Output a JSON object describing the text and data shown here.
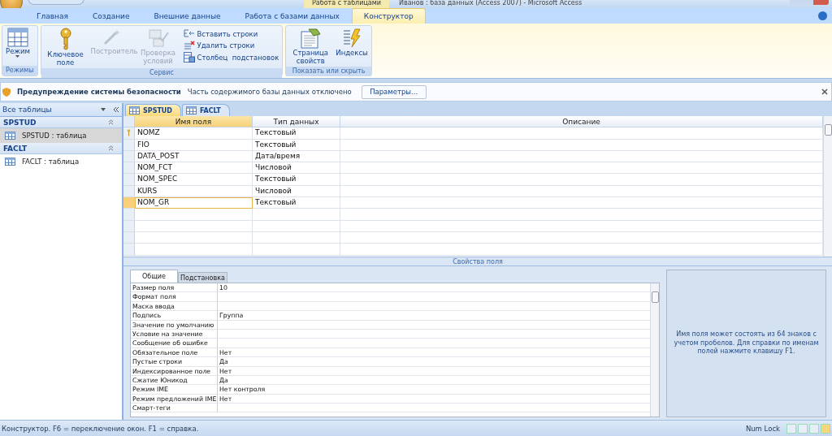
{
  "window": {
    "context_tab": "Работа с таблицами",
    "title": "Иванов : база данных (Access 2007) - Microsoft Access"
  },
  "ribbon_tabs": [
    {
      "label": "Главная",
      "selected": false
    },
    {
      "label": "Создание",
      "selected": false
    },
    {
      "label": "Внешние данные",
      "selected": false
    },
    {
      "label": "Работа с базами данных",
      "selected": false
    },
    {
      "label": "Конструктор",
      "selected": true
    }
  ],
  "ribbon_groups": [
    {
      "title": "Режимы",
      "items": [
        {
          "kind": "large",
          "label": "Режим",
          "dropdown": true,
          "disabled": false
        }
      ]
    },
    {
      "title": "Сервис",
      "items": [
        {
          "kind": "large",
          "label": "Ключевое поле",
          "disabled": false
        },
        {
          "kind": "large",
          "label": "Построитель",
          "disabled": true
        },
        {
          "kind": "large",
          "label": "Проверка условий",
          "disabled": true
        },
        {
          "kind": "small",
          "label": "Вставить строки",
          "disabled": false
        },
        {
          "kind": "small",
          "label": "Удалить строки",
          "disabled": false
        },
        {
          "kind": "small",
          "label": "Столбец  подстановок",
          "disabled": false
        }
      ]
    },
    {
      "title": "Показать или скрыть",
      "items": [
        {
          "kind": "large",
          "label": "Страница свойств",
          "disabled": false
        },
        {
          "kind": "large",
          "label": "Индексы",
          "disabled": false
        }
      ]
    }
  ],
  "security_bar": {
    "title": "Предупреждение системы безопасности",
    "message": "Часть содержимого базы данных отключено",
    "button": "Параметры..."
  },
  "navigation": {
    "header": "Все таблицы",
    "groups": [
      {
        "title": "SPSTUD",
        "items": [
          {
            "label": "SPSTUD : таблица",
            "selected": true
          }
        ]
      },
      {
        "title": "FACLT",
        "items": [
          {
            "label": "FACLT : таблица",
            "selected": false
          }
        ]
      }
    ]
  },
  "document_tabs": [
    {
      "label": "SPSTUD",
      "selected": true
    },
    {
      "label": "FACLT",
      "selected": false
    }
  ],
  "design_grid": {
    "columns": [
      "Имя поля",
      "Тип данных",
      "Описание"
    ],
    "rows": [
      {
        "name": "NOMZ",
        "type": "Текстовый",
        "key": true,
        "selected": false
      },
      {
        "name": "FIO",
        "type": "Текстовый",
        "key": false,
        "selected": false
      },
      {
        "name": "DATA_POST",
        "type": "Дата/время",
        "key": false,
        "selected": false
      },
      {
        "name": "NOM_FCT",
        "type": "Числовой",
        "key": false,
        "selected": false
      },
      {
        "name": "NOM_SPEC",
        "type": "Текстовый",
        "key": false,
        "selected": false
      },
      {
        "name": "KURS",
        "type": "Числовой",
        "key": false,
        "selected": false
      },
      {
        "name": "NOM_GR",
        "type": "Текстовый",
        "key": false,
        "selected": true
      }
    ]
  },
  "field_properties": {
    "title": "Свойства поля",
    "tabs": [
      {
        "label": "Общие",
        "selected": true
      },
      {
        "label": "Подстановка",
        "selected": false
      }
    ],
    "rows": [
      {
        "label": "Размер поля",
        "value": "10"
      },
      {
        "label": "Формат поля"
      },
      {
        "label": "Маска ввода"
      },
      {
        "label": "Подпись",
        "value": "Группа"
      },
      {
        "label": "Значение по умолчанию"
      },
      {
        "label": "Условие на значение"
      },
      {
        "label": "Сообщение об ошибке"
      },
      {
        "label": "Обязательное поле",
        "value": "Нет"
      },
      {
        "label": "Пустые строки",
        "value": "Да"
      },
      {
        "label": "Индексированное поле",
        "value": "Нет"
      },
      {
        "label": "Сжатие Юникод",
        "value": "Да"
      },
      {
        "label": "Режим IME",
        "value": "Нет контроля"
      },
      {
        "label": "Режим предложений IME",
        "value": "Нет"
      },
      {
        "label": "Смарт-теги"
      }
    ],
    "help": "Имя поля может состоять из 64 знаков с учетом пробелов.  Для справки по именам полей нажмите клавишу F1."
  },
  "status_bar": {
    "message": "Конструктор.  F6 = переключение окон.  F1 = справка.",
    "indicator": "Num Lock"
  }
}
